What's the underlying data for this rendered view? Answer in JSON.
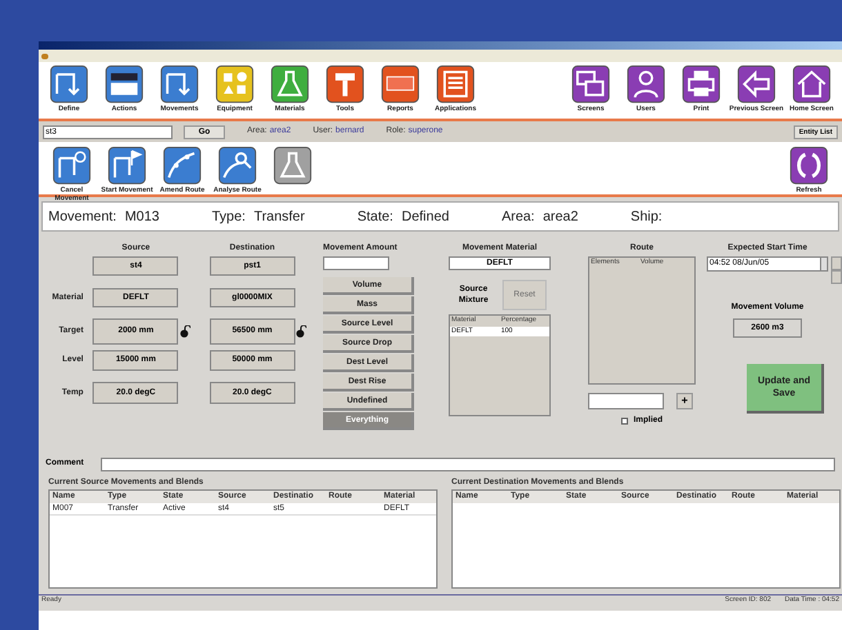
{
  "toolbar": {
    "left": [
      {
        "label": "Define",
        "kind": "pipe",
        "color": "#3b7dd0"
      },
      {
        "label": "Actions",
        "kind": "grid",
        "color": "#3b7dd0"
      },
      {
        "label": "Movements",
        "kind": "pipe",
        "color": "#3b7dd0"
      },
      {
        "label": "Equipment",
        "kind": "shapes",
        "color": "#e6c21e"
      },
      {
        "label": "Materials",
        "kind": "flask",
        "color": "#3fae3f"
      },
      {
        "label": "Tools",
        "kind": "hammer",
        "color": "#e2521e"
      },
      {
        "label": "Reports",
        "kind": "xml",
        "color": "#e2521e"
      },
      {
        "label": "Applications",
        "kind": "list",
        "color": "#e2521e"
      }
    ],
    "right": [
      {
        "label": "Screens",
        "kind": "windows",
        "color": "#8a3db3"
      },
      {
        "label": "Users",
        "kind": "person",
        "color": "#8a3db3"
      },
      {
        "label": "Print",
        "kind": "printer",
        "color": "#8a3db3"
      },
      {
        "label": "Previous Screen",
        "kind": "arrow",
        "color": "#8a3db3"
      },
      {
        "label": "Home Screen",
        "kind": "house",
        "color": "#8a3db3"
      }
    ]
  },
  "address_bar": {
    "value": "st3",
    "go": "Go",
    "area_label": "Area:",
    "area": "area2",
    "user_label": "User:",
    "user": "bernard",
    "role_label": "Role:",
    "role": "superone",
    "entity_list": "Entity List"
  },
  "actions": {
    "left": [
      {
        "label": "Cancel Movement",
        "kind": "cancel",
        "disabled": false
      },
      {
        "label": "Start Movement",
        "kind": "flag",
        "disabled": false
      },
      {
        "label": "Amend Route",
        "kind": "route",
        "disabled": false
      },
      {
        "label": "Analyse Route",
        "kind": "search",
        "disabled": false
      },
      {
        "kind": "flask",
        "disabled": true
      }
    ],
    "right": [
      {
        "label": "Refresh",
        "kind": "refresh",
        "disabled": false
      }
    ]
  },
  "header": [
    {
      "label": "Movement:",
      "value": "M013"
    },
    {
      "label": "Type:",
      "value": "Transfer"
    },
    {
      "label": "State:",
      "value": "Defined"
    },
    {
      "label": "Area:",
      "value": "area2"
    },
    {
      "label": "Ship:"
    }
  ],
  "equipment": {
    "source_heading": "Source",
    "destination_heading": "Destination",
    "rows": [
      {
        "source": "st4",
        "destination": "pst1"
      },
      {
        "label": "Material",
        "source": "DEFLT",
        "destination": "gl0000MIX"
      },
      {
        "label": "Target",
        "source": "2000 mm",
        "destination": "56500 mm",
        "lock": true
      },
      {
        "label": "Level",
        "source": "15000 mm",
        "destination": "50000 mm"
      },
      {
        "label": "Temp",
        "source": "20.0 degC",
        "destination": "20.0 degC"
      }
    ]
  },
  "movement_amount": {
    "heading": "Movement Amount",
    "options": [
      {
        "label": "Volume",
        "selected": false
      },
      {
        "label": "Mass",
        "selected": false
      },
      {
        "label": "Source Level",
        "selected": false
      },
      {
        "label": "Source Drop",
        "selected": false
      },
      {
        "label": "Dest Level",
        "selected": false
      },
      {
        "label": "Dest Rise",
        "selected": false
      },
      {
        "label": "Undefined",
        "selected": false
      },
      {
        "label": "Everything",
        "selected": true
      }
    ]
  },
  "movement_material": {
    "heading": "Movement Material",
    "value": "DEFLT",
    "source_mixture_label": "Source Mixture",
    "reset": "Reset",
    "columns": [
      "Material",
      "Percentage"
    ],
    "rows": [
      [
        "DEFLT",
        "100"
      ]
    ]
  },
  "route": {
    "heading": "Route",
    "columns": [
      "Elements",
      "Volume"
    ],
    "add": "+",
    "implied_label": "Implied",
    "implied_checked": false
  },
  "schedule": {
    "heading": "Expected Start Time",
    "value": "04:52 08/Jun/05",
    "volume_label": "Movement Volume",
    "volume": "2600 m3",
    "update": "Update and Save"
  },
  "comment_label": "Comment",
  "source_movements": {
    "title": "Current Source Movements and Blends",
    "columns": [
      "Name",
      "Type",
      "State",
      "Source",
      "Destinatio",
      "Route",
      "Material"
    ],
    "rows": [
      [
        "M007",
        "Transfer",
        "Active",
        "st4",
        "st5",
        "",
        "DEFLT"
      ]
    ]
  },
  "destination_movements": {
    "title": "Current Destination Movements and Blends",
    "columns": [
      "Name",
      "Type",
      "State",
      "Source",
      "Destinatio",
      "Route",
      "Material"
    ]
  },
  "status_bar": {
    "left": "Ready",
    "screen_id": "Screen ID: 802",
    "date_time": "Data Time : 04:52"
  }
}
